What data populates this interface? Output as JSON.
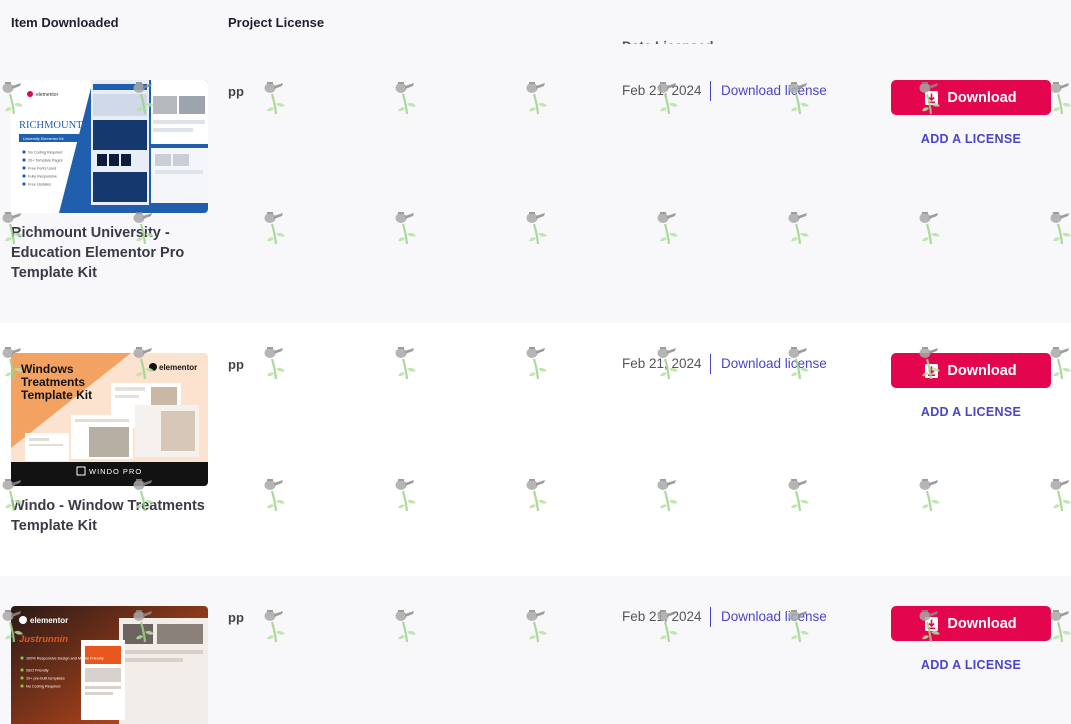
{
  "header": {
    "item_downloaded": "Item Downloaded",
    "project_license": "Project License",
    "date_licensed": "Date Licensed"
  },
  "rows": [
    {
      "title": "Richmount University - Education Elementor Pro Template Kit",
      "license": "pp",
      "date": "Feb 21, 2024",
      "download_license": "Download license",
      "download_button": "Download",
      "add_license": "ADD A LICENSE",
      "thumb": {
        "brand": "elementor",
        "heading": "RICHMOUNT",
        "badge": "University Elementor Kit",
        "bullets": [
          "No Coding Required",
          "20+ Template Pages",
          "Free Fonts Used",
          "Fully Responsive",
          "Free Updates"
        ],
        "colors": {
          "bg": "#ffffff",
          "accent": "#1f5fae",
          "dark": "#15386e"
        }
      }
    },
    {
      "title": "Windo - Window Treatments Template Kit",
      "license": "pp",
      "date": "Feb 21, 2024",
      "download_license": "Download license",
      "download_button": "Download",
      "add_license": "ADD A LICENSE",
      "thumb": {
        "brand": "elementor",
        "heading": "Windows Treatments Template Kit",
        "footer": "WINDO PRO",
        "colors": {
          "bg": "#fbe3cf",
          "accent": "#f4a262",
          "dark": "#121212"
        }
      }
    },
    {
      "title": "",
      "license": "pp",
      "date": "Feb 21, 2024",
      "download_license": "Download license",
      "download_button": "Download",
      "add_license": "ADD A LICENSE",
      "thumb": {
        "brand": "elementor",
        "heading": "Justrunnin",
        "bullets": [
          "100% Responsive Design and Mobile Friendly",
          "SEO Friendly",
          "10+ pre-built templates",
          "No Coding Required"
        ],
        "colors": {
          "bg": "#2a1a16",
          "accent": "#e8561e",
          "dark": "#1a0f0c"
        }
      }
    }
  ],
  "colors": {
    "primary_button": "#e4054f",
    "link": "#4b44c6",
    "row_alt": "#f8f8fb"
  },
  "icons": {
    "download": "download-icon",
    "watermark": "watering-can-icon"
  }
}
